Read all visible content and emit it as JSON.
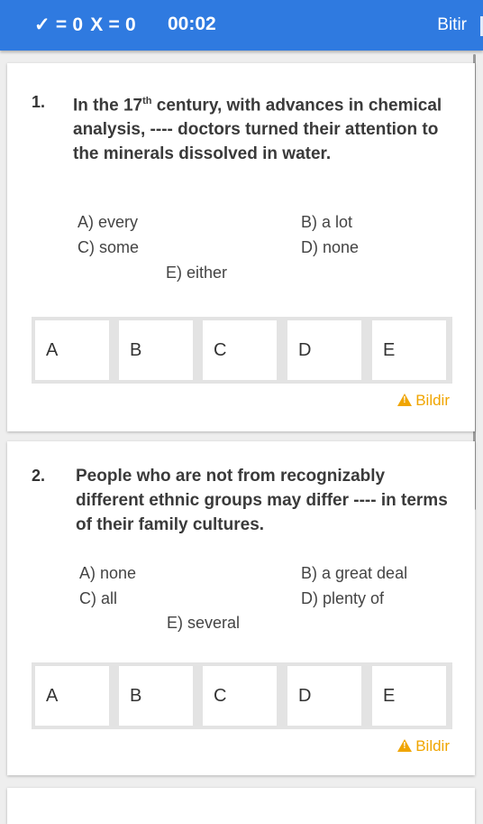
{
  "header": {
    "correct_label": "✓ = 0",
    "wrong_label": "X = 0",
    "timer": "00:02",
    "finish_label": "Bitir"
  },
  "questions": [
    {
      "number": "1.",
      "text_before_sup": "In the 17",
      "text_sup": "th",
      "text_after_sup": " century, with advances in chemical analysis, ---- doctors turned their attention to the minerals dissolved in water.",
      "options": {
        "a": "A) every",
        "b": "B) a lot",
        "c": "C) some",
        "d": "D) none",
        "e": "E) either"
      },
      "answer_buttons": [
        "A",
        "B",
        "C",
        "D",
        "E"
      ],
      "report_label": "Bildir"
    },
    {
      "number": "2.",
      "text": "People who are not from recognizably different ethnic groups may differ ---- in terms of their family cultures.",
      "options": {
        "a": "A) none",
        "b": "B) a great deal",
        "c": "C) all",
        "d": "D) plenty of",
        "e": "E) several"
      },
      "answer_buttons": [
        "A",
        "B",
        "C",
        "D",
        "E"
      ],
      "report_label": "Bildir"
    }
  ],
  "colors": {
    "header_bg": "#2f7ae0",
    "report": "#f0a500",
    "page_bg": "#eeeeee"
  }
}
